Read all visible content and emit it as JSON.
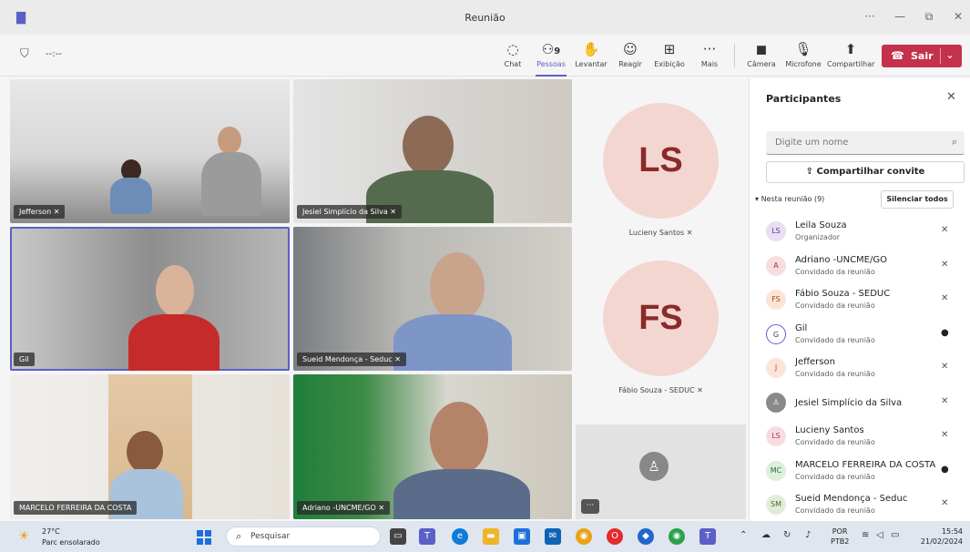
{
  "window": {
    "title": "Reunião",
    "more": "···",
    "minimize": "—",
    "restore": "⧉",
    "close": "✕"
  },
  "toolbar": {
    "timer": "--:--",
    "buttons": [
      {
        "label": "Chat",
        "icon": "chat-icon"
      },
      {
        "label": "Pessoas",
        "icon": "people-icon",
        "count": "9"
      },
      {
        "label": "Levantar",
        "icon": "raise-hand-icon"
      },
      {
        "label": "Reagir",
        "icon": "react-icon"
      },
      {
        "label": "Exibição",
        "icon": "view-icon"
      },
      {
        "label": "Mais",
        "icon": "more-icon"
      },
      {
        "label": "Câmera",
        "icon": "camera-off-icon"
      },
      {
        "label": "Microfone",
        "icon": "mic-off-icon"
      },
      {
        "label": "Compartilhar",
        "icon": "share-icon"
      }
    ],
    "leave_label": "Sair",
    "leave_color": "#c4314b",
    "accent": "#5b5fc7"
  },
  "tiles": [
    {
      "name": "Jefferson"
    },
    {
      "name": "Jesiel Simplício da Silva"
    },
    {
      "name": "Gil"
    },
    {
      "name": "Sueid Mendonça - Seduc"
    },
    {
      "name": "MARCELO FERREIRA DA COSTA"
    },
    {
      "name": "Adriano -UNCME/GO"
    }
  ],
  "avatar_tiles": [
    {
      "initials": "LS",
      "name": "Lucieny Santos"
    },
    {
      "initials": "FS",
      "name": "Fábio Souza - SEDUC"
    }
  ],
  "more_tile": "···",
  "participants": {
    "title": "Participantes",
    "search_placeholder": "Digite um nome",
    "share_invite": "Compartilhar convite",
    "section_label": "Nesta reunião (9)",
    "mute_all": "Silenciar todos",
    "list": [
      {
        "initials": "LS",
        "name": "Leila Souza",
        "role": "Organizador",
        "mic": "muted"
      },
      {
        "initials": "A",
        "name": "Adriano -UNCME/GO",
        "role": "Convidado da reunião",
        "mic": "muted"
      },
      {
        "initials": "FS",
        "name": "Fábio Souza - SEDUC",
        "role": "Convidado da reunião",
        "mic": "muted"
      },
      {
        "initials": "G",
        "name": "Gil",
        "role": "Convidado da reunião",
        "mic": "on"
      },
      {
        "initials": "J",
        "name": "Jefferson",
        "role": "Convidado da reunião",
        "mic": "muted"
      },
      {
        "initials": "",
        "name": "Jesiel Simplício da Silva",
        "role": "",
        "mic": "muted"
      },
      {
        "initials": "LS",
        "name": "Lucieny Santos",
        "role": "Convidado da reunião",
        "mic": "muted"
      },
      {
        "initials": "MC",
        "name": "MARCELO FERREIRA DA COSTA",
        "role": "Convidado da reunião",
        "mic": "on"
      },
      {
        "initials": "SM",
        "name": "Sueid Mendonça - Seduc",
        "role": "Convidado da reunião",
        "mic": "muted"
      }
    ]
  },
  "taskbar": {
    "temperature": "27°C",
    "weather": "Parc ensolarado",
    "search_label": "Pesquisar",
    "lang_top": "POR",
    "lang_bottom": "PTB2",
    "time": "15:54",
    "date": "21/02/2024"
  }
}
